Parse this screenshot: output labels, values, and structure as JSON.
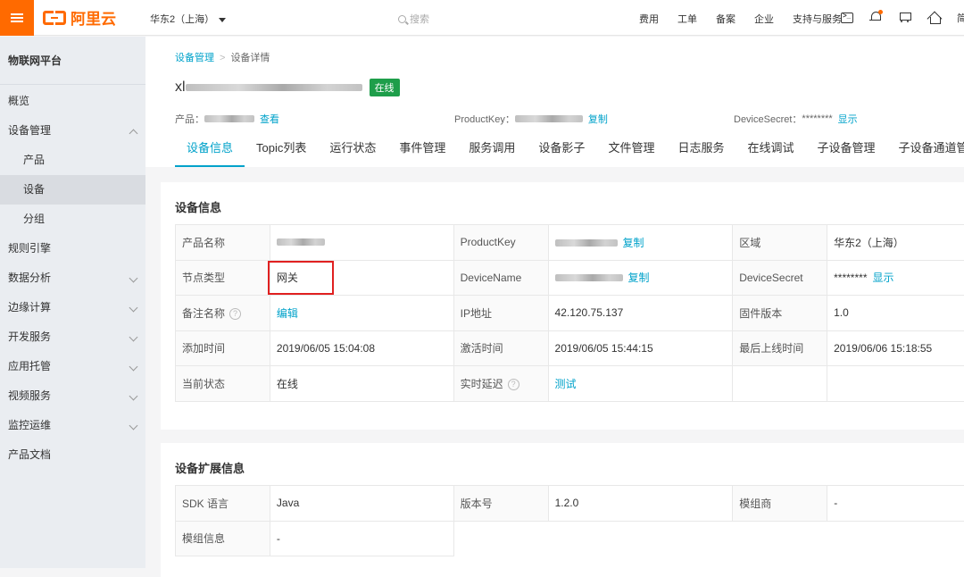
{
  "topbar": {
    "logo_text": "阿里云",
    "region": "华东2（上海）",
    "search_placeholder": "搜索",
    "nav": [
      "费用",
      "工单",
      "备案",
      "企业",
      "支持与服务"
    ],
    "edge_text": "简"
  },
  "sidebar": {
    "title": "物联网平台",
    "items": [
      {
        "label": "概览",
        "type": "top"
      },
      {
        "label": "设备管理",
        "type": "expanded"
      },
      {
        "label": "产品",
        "type": "sub"
      },
      {
        "label": "设备",
        "type": "sub-active"
      },
      {
        "label": "分组",
        "type": "sub"
      },
      {
        "label": "规则引擎",
        "type": "top"
      },
      {
        "label": "数据分析",
        "type": "collapsed"
      },
      {
        "label": "边缘计算",
        "type": "collapsed"
      },
      {
        "label": "开发服务",
        "type": "collapsed"
      },
      {
        "label": "应用托管",
        "type": "collapsed"
      },
      {
        "label": "视频服务",
        "type": "collapsed"
      },
      {
        "label": "监控运维",
        "type": "collapsed"
      },
      {
        "label": "产品文档",
        "type": "top"
      }
    ]
  },
  "header": {
    "breadcrumb": {
      "root": "设备管理",
      "sep": ">",
      "current": "设备详情"
    },
    "device_prefix": "xl",
    "status_tag": "在线",
    "product_label": "产品：",
    "product_link": "查看",
    "productkey_label": "ProductKey：",
    "productkey_link": "复制",
    "devicesecret_label": "DeviceSecret：",
    "devicesecret_value": "********",
    "devicesecret_link": "显示"
  },
  "tabs": [
    "设备信息",
    "Topic列表",
    "运行状态",
    "事件管理",
    "服务调用",
    "设备影子",
    "文件管理",
    "日志服务",
    "在线调试",
    "子设备管理",
    "子设备通道管理"
  ],
  "device_info": {
    "title": "设备信息",
    "rows": [
      {
        "l1": "产品名称",
        "v1": "",
        "l2": "ProductKey",
        "v2": "",
        "v2_link": "复制",
        "l3": "区域",
        "v3": "华东2（上海）"
      },
      {
        "l1": "节点类型",
        "v1": "网关",
        "l2": "DeviceName",
        "v2": "",
        "v2_link": "复制",
        "l3": "DeviceSecret",
        "v3": "********",
        "v3_link": "显示"
      },
      {
        "l1": "备注名称",
        "v1_link": "编辑",
        "l2": "IP地址",
        "v2": "42.120.75.137",
        "l3": "固件版本",
        "v3": "1.0"
      },
      {
        "l1": "添加时间",
        "v1": "2019/06/05 15:04:08",
        "l2": "激活时间",
        "v2": "2019/06/05 15:44:15",
        "l3": "最后上线时间",
        "v3": "2019/06/06 15:18:55"
      },
      {
        "l1": "当前状态",
        "v1": "在线",
        "l2": "实时延迟",
        "v2_link": "测试"
      }
    ],
    "help_glyph": "?"
  },
  "ext_info": {
    "title": "设备扩展信息",
    "rows": [
      {
        "l1": "SDK 语言",
        "v1": "Java",
        "l2": "版本号",
        "v2": "1.2.0",
        "l3": "模组商",
        "v3": "-"
      },
      {
        "l1": "模组信息",
        "v1": "-"
      }
    ]
  },
  "colors": {
    "brand": "#ff6a00",
    "link": "#00a2ca",
    "online": "#1e9e4a",
    "highlight": "#e02020"
  }
}
